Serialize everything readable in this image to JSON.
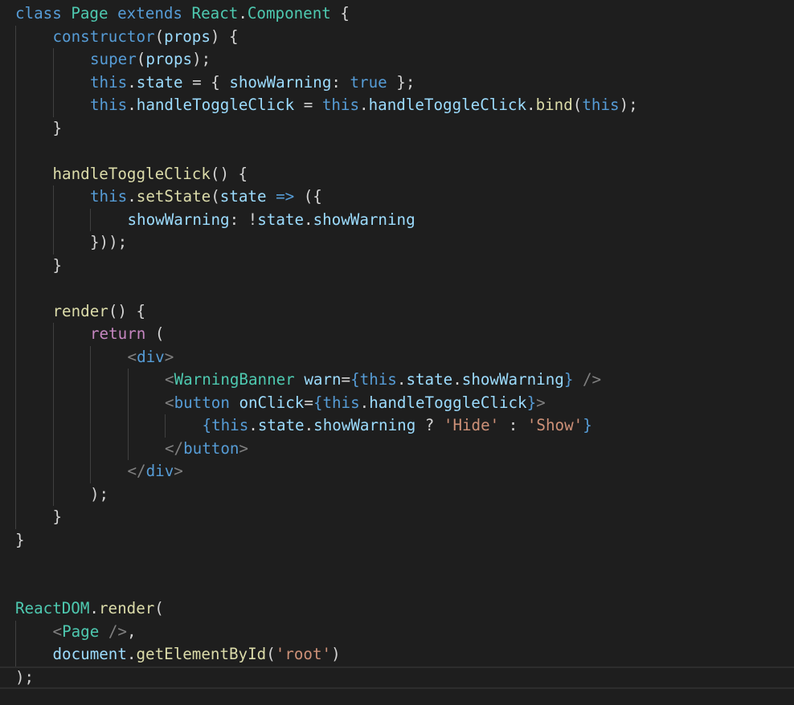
{
  "editor": {
    "language": "javascript-jsx",
    "theme": "dark",
    "colors": {
      "background": "#1e1e1e",
      "keyword": "#569cd6",
      "control": "#c586c0",
      "type": "#4ec9b0",
      "function": "#dcdcaa",
      "variable": "#9cdcfe",
      "string": "#ce9178",
      "tag_bracket": "#808080",
      "plain": "#d4d4d4"
    },
    "lines": [
      {
        "indent": 0,
        "tokens": [
          [
            "kw",
            "class"
          ],
          [
            "pun",
            " "
          ],
          [
            "cls",
            "Page"
          ],
          [
            "pun",
            " "
          ],
          [
            "kw",
            "extends"
          ],
          [
            "pun",
            " "
          ],
          [
            "cls",
            "React"
          ],
          [
            "pun",
            "."
          ],
          [
            "cls",
            "Component"
          ],
          [
            "pun",
            " {"
          ]
        ]
      },
      {
        "indent": 1,
        "tokens": [
          [
            "kw",
            "constructor"
          ],
          [
            "pun",
            "("
          ],
          [
            "var",
            "props"
          ],
          [
            "pun",
            ") {"
          ]
        ]
      },
      {
        "indent": 2,
        "tokens": [
          [
            "kw",
            "super"
          ],
          [
            "pun",
            "("
          ],
          [
            "var",
            "props"
          ],
          [
            "pun",
            ");"
          ]
        ]
      },
      {
        "indent": 2,
        "tokens": [
          [
            "kw",
            "this"
          ],
          [
            "pun",
            "."
          ],
          [
            "var",
            "state"
          ],
          [
            "pun",
            " = { "
          ],
          [
            "var",
            "showWarning"
          ],
          [
            "pun",
            ": "
          ],
          [
            "kw",
            "true"
          ],
          [
            "pun",
            " };"
          ]
        ]
      },
      {
        "indent": 2,
        "tokens": [
          [
            "kw",
            "this"
          ],
          [
            "pun",
            "."
          ],
          [
            "var",
            "handleToggleClick"
          ],
          [
            "pun",
            " = "
          ],
          [
            "kw",
            "this"
          ],
          [
            "pun",
            "."
          ],
          [
            "var",
            "handleToggleClick"
          ],
          [
            "pun",
            "."
          ],
          [
            "fn",
            "bind"
          ],
          [
            "pun",
            "("
          ],
          [
            "kw",
            "this"
          ],
          [
            "pun",
            ");"
          ]
        ]
      },
      {
        "indent": 1,
        "tokens": [
          [
            "pun",
            "}"
          ]
        ]
      },
      {
        "indent": 0,
        "tokens": []
      },
      {
        "indent": 1,
        "tokens": [
          [
            "fn",
            "handleToggleClick"
          ],
          [
            "pun",
            "() {"
          ]
        ]
      },
      {
        "indent": 2,
        "tokens": [
          [
            "kw",
            "this"
          ],
          [
            "pun",
            "."
          ],
          [
            "fn",
            "setState"
          ],
          [
            "pun",
            "("
          ],
          [
            "var",
            "state"
          ],
          [
            "pun",
            " "
          ],
          [
            "kw",
            "=>"
          ],
          [
            "pun",
            " ({"
          ]
        ]
      },
      {
        "indent": 3,
        "tokens": [
          [
            "var",
            "showWarning"
          ],
          [
            "pun",
            ": !"
          ],
          [
            "var",
            "state"
          ],
          [
            "pun",
            "."
          ],
          [
            "var",
            "showWarning"
          ]
        ]
      },
      {
        "indent": 2,
        "tokens": [
          [
            "pun",
            "}));"
          ]
        ]
      },
      {
        "indent": 1,
        "tokens": [
          [
            "pun",
            "}"
          ]
        ]
      },
      {
        "indent": 0,
        "tokens": []
      },
      {
        "indent": 1,
        "tokens": [
          [
            "fn",
            "render"
          ],
          [
            "pun",
            "() {"
          ]
        ]
      },
      {
        "indent": 2,
        "tokens": [
          [
            "kw2",
            "return"
          ],
          [
            "pun",
            " ("
          ]
        ]
      },
      {
        "indent": 3,
        "tokens": [
          [
            "tag",
            "<"
          ],
          [
            "kw",
            "div"
          ],
          [
            "tag",
            ">"
          ]
        ]
      },
      {
        "indent": 4,
        "tokens": [
          [
            "tag",
            "<"
          ],
          [
            "cls",
            "WarningBanner"
          ],
          [
            "pun",
            " "
          ],
          [
            "var",
            "warn"
          ],
          [
            "pun",
            "="
          ],
          [
            "kw",
            "{"
          ],
          [
            "kw",
            "this"
          ],
          [
            "pun",
            "."
          ],
          [
            "var",
            "state"
          ],
          [
            "pun",
            "."
          ],
          [
            "var",
            "showWarning"
          ],
          [
            "kw",
            "}"
          ],
          [
            "pun",
            " "
          ],
          [
            "tag",
            "/>"
          ]
        ]
      },
      {
        "indent": 4,
        "tokens": [
          [
            "tag",
            "<"
          ],
          [
            "kw",
            "button"
          ],
          [
            "pun",
            " "
          ],
          [
            "var",
            "onClick"
          ],
          [
            "pun",
            "="
          ],
          [
            "kw",
            "{"
          ],
          [
            "kw",
            "this"
          ],
          [
            "pun",
            "."
          ],
          [
            "var",
            "handleToggleClick"
          ],
          [
            "kw",
            "}"
          ],
          [
            "tag",
            ">"
          ]
        ]
      },
      {
        "indent": 5,
        "tokens": [
          [
            "kw",
            "{"
          ],
          [
            "kw",
            "this"
          ],
          [
            "pun",
            "."
          ],
          [
            "var",
            "state"
          ],
          [
            "pun",
            "."
          ],
          [
            "var",
            "showWarning"
          ],
          [
            "pun",
            " ? "
          ],
          [
            "str",
            "'Hide'"
          ],
          [
            "pun",
            " : "
          ],
          [
            "str",
            "'Show'"
          ],
          [
            "kw",
            "}"
          ]
        ]
      },
      {
        "indent": 4,
        "tokens": [
          [
            "tag",
            "</"
          ],
          [
            "kw",
            "button"
          ],
          [
            "tag",
            ">"
          ]
        ]
      },
      {
        "indent": 3,
        "tokens": [
          [
            "tag",
            "</"
          ],
          [
            "kw",
            "div"
          ],
          [
            "tag",
            ">"
          ]
        ]
      },
      {
        "indent": 2,
        "tokens": [
          [
            "pun",
            ");"
          ]
        ]
      },
      {
        "indent": 1,
        "tokens": [
          [
            "pun",
            "}"
          ]
        ]
      },
      {
        "indent": 0,
        "tokens": [
          [
            "pun",
            "}"
          ]
        ]
      },
      {
        "indent": 0,
        "tokens": []
      },
      {
        "indent": 0,
        "tokens": []
      },
      {
        "indent": 0,
        "tokens": [
          [
            "cls",
            "ReactDOM"
          ],
          [
            "pun",
            "."
          ],
          [
            "fn",
            "render"
          ],
          [
            "pun",
            "("
          ]
        ]
      },
      {
        "indent": 1,
        "tokens": [
          [
            "tag",
            "<"
          ],
          [
            "cls",
            "Page"
          ],
          [
            "pun",
            " "
          ],
          [
            "tag",
            "/>"
          ],
          [
            "pun",
            ","
          ]
        ]
      },
      {
        "indent": 1,
        "tokens": [
          [
            "var",
            "document"
          ],
          [
            "pun",
            "."
          ],
          [
            "fn",
            "getElementById"
          ],
          [
            "pun",
            "("
          ],
          [
            "str",
            "'root'"
          ],
          [
            "pun",
            ")"
          ]
        ]
      },
      {
        "indent": 0,
        "tokens": [
          [
            "pun",
            ");"
          ]
        ]
      }
    ],
    "current_line": 29
  }
}
